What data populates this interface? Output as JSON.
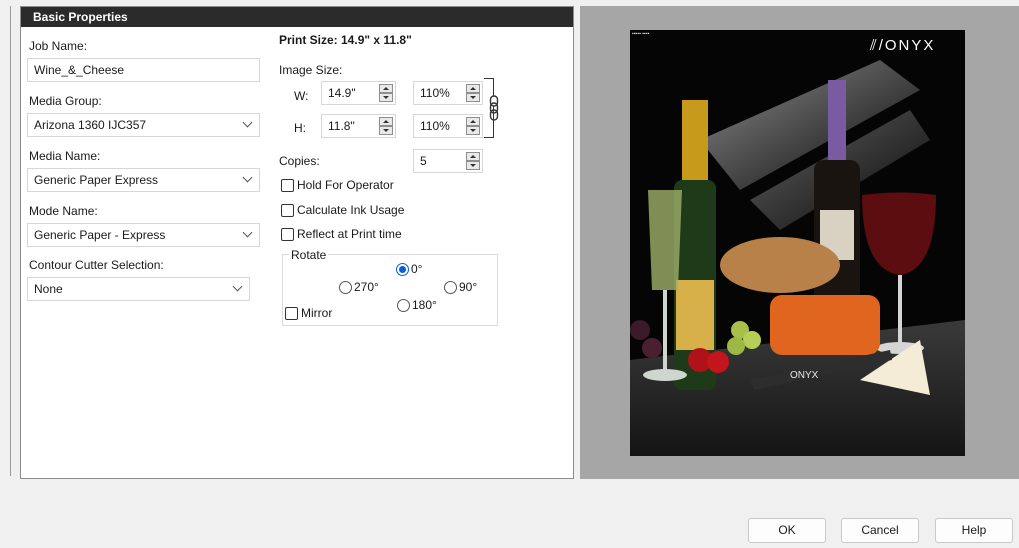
{
  "panel": {
    "title": "Basic Properties",
    "job_name_label": "Job Name:",
    "job_name_value": "Wine_&_Cheese",
    "media_group_label": "Media Group:",
    "media_group_value": "Arizona 1360 IJC357",
    "media_name_label": "Media Name:",
    "media_name_value": "Generic Paper Express",
    "mode_name_label": "Mode Name:",
    "mode_name_value": "Generic Paper - Express",
    "contour_label": "Contour Cutter Selection:",
    "contour_value": "None"
  },
  "print": {
    "print_size": "Print Size: 14.9\" x 11.8\"",
    "image_size_label": "Image Size:",
    "w_label": "W:",
    "w_value": "14.9\"",
    "w_percent": "110%",
    "h_label": "H:",
    "h_value": "11.8\"",
    "h_percent": "110%",
    "copies_label": "Copies:",
    "copies_value": "5",
    "hold_label": "Hold For Operator",
    "ink_label": "Calculate Ink Usage",
    "reflect_label": "Reflect at Print time",
    "rotate_label": "Rotate",
    "rot_0": "0°",
    "rot_90": "90°",
    "rot_180": "180°",
    "rot_270": "270°",
    "mirror_label": "Mirror",
    "selected_rotation": "0°"
  },
  "preview": {
    "brand": "ONYX",
    "knife_brand": "ONYX"
  },
  "footer": {
    "ok_label": "OK",
    "cancel_label": "Cancel",
    "help_label": "Help"
  },
  "colors": {
    "header_bg": "#2b2b2b",
    "accent": "#0b5ed7",
    "preview_bg": "#a6a6a6"
  }
}
